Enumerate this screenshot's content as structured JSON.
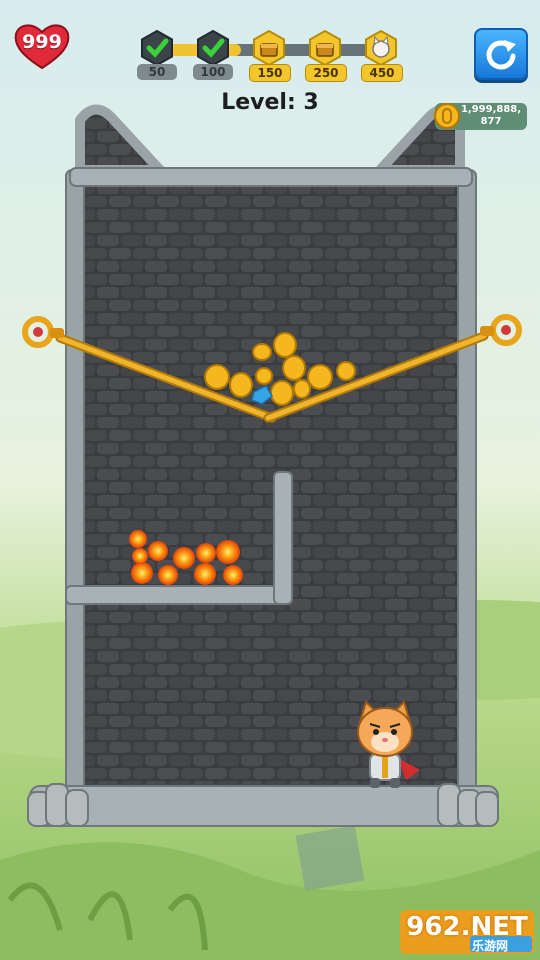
{
  "hud": {
    "lives": "999",
    "level_label": "Level: 3",
    "coins": "1,999,888,\n877",
    "restart_icon": "restart-icon",
    "progress_fraction": 0.38,
    "milestones": [
      {
        "value": "50",
        "status": "completed",
        "icon": "check-icon"
      },
      {
        "value": "100",
        "status": "completed",
        "icon": "check-icon"
      },
      {
        "value": "150",
        "status": "locked",
        "icon": "chest-icon"
      },
      {
        "value": "250",
        "status": "locked",
        "icon": "chest-icon"
      },
      {
        "value": "450",
        "status": "locked",
        "icon": "cat-icon"
      }
    ]
  },
  "scene": {
    "pins": [
      {
        "name": "left-pin",
        "icon": "pin-handle-icon"
      },
      {
        "name": "right-pin",
        "icon": "pin-handle-icon"
      }
    ],
    "treasure": "gold-coins",
    "hazard": "lava",
    "hero": "cat-knight",
    "colors": {
      "stone_dark": "#3a3c3f",
      "stone_border": "#9aa4a6",
      "pin_gold": "#e8a51c",
      "lava": "#ff9a14"
    }
  },
  "watermark": {
    "main": "962.NET",
    "sub": "乐游网"
  }
}
